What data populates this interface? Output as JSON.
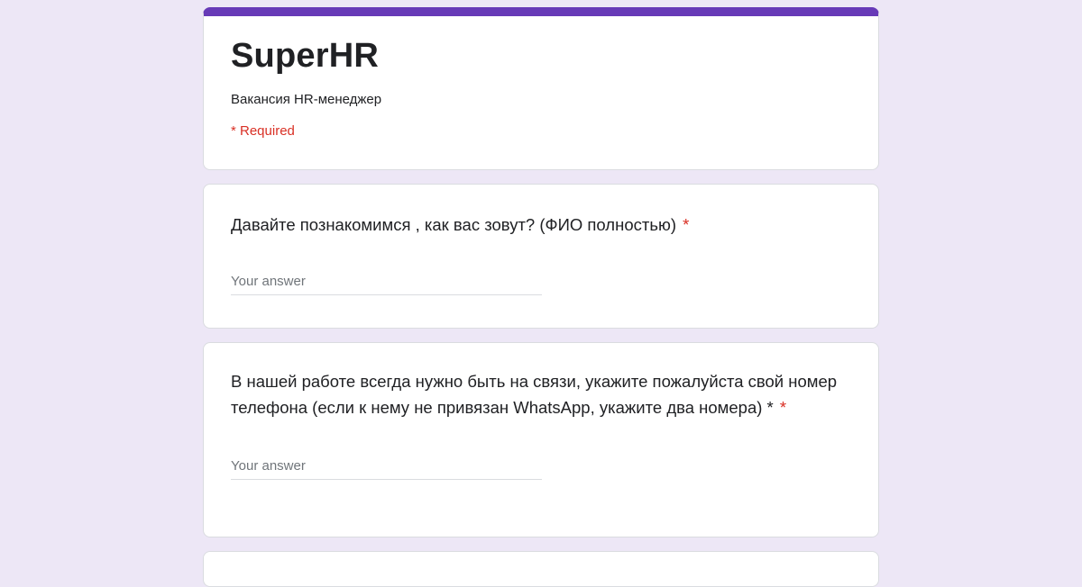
{
  "form": {
    "title": "SuperHR",
    "description": "Вакансия HR-менеджер",
    "required_note": "* Required",
    "accent_color": "#673ab7",
    "background_color": "#ede7f6"
  },
  "questions": [
    {
      "text": "Давайте познакомимся , как вас зовут? (ФИО полностью)",
      "required_star": "*",
      "placeholder": "Your answer"
    },
    {
      "text": "В нашей работе всегда нужно быть на связи, укажите пожалуйста свой номер телефона (если к нему не привязан WhatsApp, укажите два номера) *",
      "required_star": "*",
      "placeholder": "Your answer"
    }
  ]
}
